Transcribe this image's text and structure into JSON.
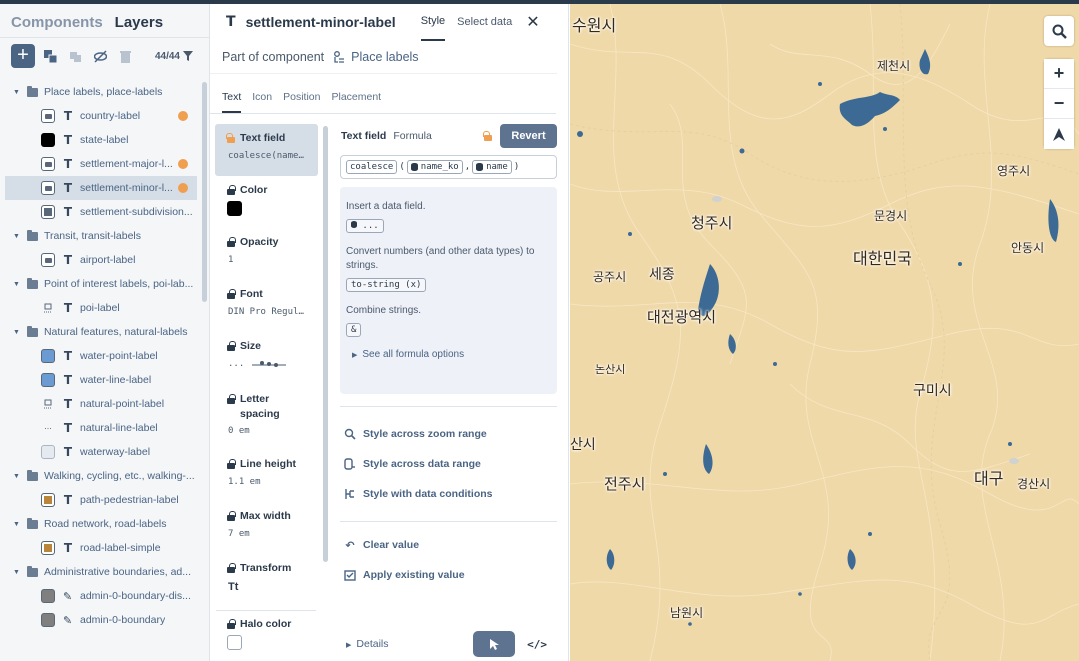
{
  "sidebar": {
    "tabs": [
      "Components",
      "Layers"
    ],
    "active_tab": "Layers",
    "layer_count": "44/44",
    "groups": [
      {
        "label": "Place labels, place-labels",
        "layers": [
          {
            "name": "country-label",
            "icon": "image",
            "dot": true
          },
          {
            "name": "state-label",
            "icon": "black",
            "dot": false
          },
          {
            "name": "settlement-major-l...",
            "icon": "image",
            "dot": true
          },
          {
            "name": "settlement-minor-l...",
            "icon": "image",
            "dot": true,
            "selected": true
          },
          {
            "name": "settlement-subdivision...",
            "icon": "gray",
            "dot": false
          }
        ]
      },
      {
        "label": "Transit, transit-labels",
        "layers": [
          {
            "name": "airport-label",
            "icon": "image",
            "dot": false
          }
        ]
      },
      {
        "label": "Point of interest labels, poi-lab...",
        "layers": [
          {
            "name": "poi-label",
            "icon": "plain",
            "dot": false
          }
        ]
      },
      {
        "label": "Natural features, natural-labels",
        "layers": [
          {
            "name": "water-point-label",
            "icon": "blue",
            "dot": false
          },
          {
            "name": "water-line-label",
            "icon": "blue",
            "dot": false
          },
          {
            "name": "natural-point-label",
            "icon": "plain",
            "dot": false
          },
          {
            "name": "natural-line-label",
            "icon": "dots",
            "dot": false
          },
          {
            "name": "waterway-label",
            "icon": "lightblue",
            "dot": false
          }
        ]
      },
      {
        "label": "Walking, cycling, etc., walking-...",
        "layers": [
          {
            "name": "path-pedestrian-label",
            "icon": "tan",
            "dot": false
          }
        ]
      },
      {
        "label": "Road network, road-labels",
        "layers": [
          {
            "name": "road-label-simple",
            "icon": "tan",
            "dot": false
          }
        ]
      },
      {
        "label": "Administrative boundaries, ad...",
        "layers": [
          {
            "name": "admin-0-boundary-dis...",
            "icon": "gray2",
            "type": "line",
            "dot": false
          },
          {
            "name": "admin-0-boundary",
            "icon": "gray2",
            "type": "line",
            "dot": false
          }
        ]
      }
    ]
  },
  "editor": {
    "layer_name": "settlement-minor-label",
    "tabs": {
      "style": "Style",
      "select_data": "Select data"
    },
    "part_of_label": "Part of component",
    "component_name": "Place labels",
    "subtabs": [
      "Text",
      "Icon",
      "Position",
      "Placement"
    ],
    "properties": [
      {
        "label": "Text field",
        "value": "coalesce(name_...",
        "active": true,
        "lock": "open"
      },
      {
        "label": "Color",
        "swatch": "#000000"
      },
      {
        "label": "Opacity",
        "value": "1"
      },
      {
        "label": "Font",
        "value": "DIN Pro Regul..."
      },
      {
        "label": "Size",
        "value": "..."
      },
      {
        "label": "Letter spacing",
        "value": "0 em"
      },
      {
        "label": "Line height",
        "value": "1.1 em"
      },
      {
        "label": "Max width",
        "value": "7 em"
      },
      {
        "label": "Transform",
        "value": "Tt"
      },
      {
        "label": "Halo color",
        "swatch": "#ffffff"
      }
    ],
    "text_field": {
      "label": "Text field",
      "formula_label": "Formula",
      "revert_label": "Revert",
      "expr_fn": "coalesce",
      "expr_arg1": "name_ko",
      "expr_arg2": "name",
      "help": [
        {
          "text": "Insert a data field.",
          "chip": "..."
        },
        {
          "text": "Convert numbers (and other data types) to strings.",
          "chip": "to-string (x)"
        },
        {
          "text": "Combine strings.",
          "chip": "&"
        }
      ],
      "see_all": "See all formula options"
    },
    "actions": [
      "Style across zoom range",
      "Style across data range",
      "Style with data conditions"
    ],
    "value_actions": [
      "Clear value",
      "Apply existing value"
    ],
    "details_label": "Details",
    "code_label": "</>"
  },
  "map": {
    "labels": [
      {
        "text": "수원시",
        "size": 16
      },
      {
        "text": "제천시",
        "size": 12
      },
      {
        "text": "영주시",
        "size": 12
      },
      {
        "text": "청주시",
        "size": 15
      },
      {
        "text": "문경시",
        "size": 12
      },
      {
        "text": "세종",
        "size": 14
      },
      {
        "text": "공주시",
        "size": 12
      },
      {
        "text": "대한민국",
        "size": 16
      },
      {
        "text": "안동시",
        "size": 12
      },
      {
        "text": "대전광역시",
        "size": 15
      },
      {
        "text": "논산시",
        "size": 11
      },
      {
        "text": "구미시",
        "size": 14
      },
      {
        "text": "산시",
        "size": 14
      },
      {
        "text": "전주시",
        "size": 15
      },
      {
        "text": "대구",
        "size": 16
      },
      {
        "text": "경산시",
        "size": 12
      },
      {
        "text": "남원시",
        "size": 12
      }
    ],
    "controls": [
      "search-icon",
      "zoom-in-icon",
      "zoom-out-icon",
      "compass-icon"
    ]
  }
}
